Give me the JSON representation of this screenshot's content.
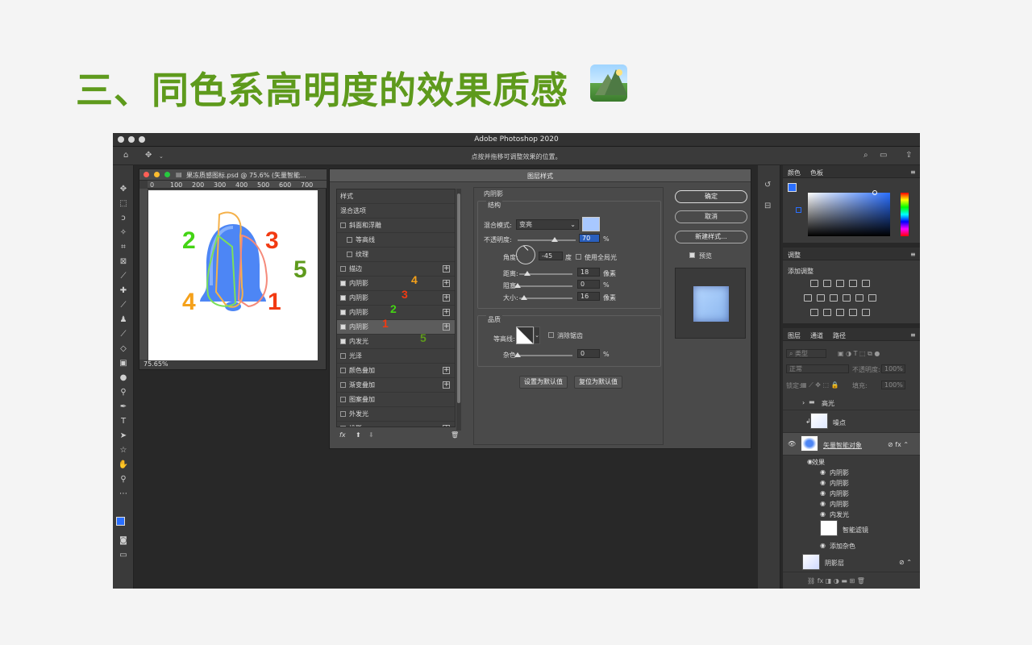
{
  "slide": {
    "title": "三、同色系高明度的效果质感"
  },
  "app": {
    "title": "Adobe Photoshop 2020",
    "hint": "点按并拖移可调整效果的位置。"
  },
  "document": {
    "title": "果冻质感图标.psd @ 75.6% (矢量智能...",
    "zoom": "75.65%",
    "ruler": [
      "0",
      "100",
      "200",
      "300",
      "400",
      "500",
      "600",
      "700"
    ],
    "labels": [
      {
        "text": "2",
        "color": "#44d414"
      },
      {
        "text": "3",
        "color": "#f23a12"
      },
      {
        "text": "5",
        "color": "#5e9a1c"
      },
      {
        "text": "4",
        "color": "#f5a11a"
      },
      {
        "text": "1",
        "color": "#f23a12"
      }
    ]
  },
  "dialog": {
    "title": "图层样式",
    "style_list": [
      {
        "label": "样式",
        "checkbox": false,
        "plus": false,
        "indent": 0
      },
      {
        "label": "混合选项",
        "checkbox": false,
        "plus": false,
        "indent": 0
      },
      {
        "label": "斜面和浮雕",
        "checkbox": true,
        "checked": false,
        "plus": false,
        "indent": 0
      },
      {
        "label": "等高线",
        "checkbox": true,
        "checked": false,
        "plus": false,
        "indent": 1
      },
      {
        "label": "纹理",
        "checkbox": true,
        "checked": false,
        "plus": false,
        "indent": 1
      },
      {
        "label": "描边",
        "checkbox": true,
        "checked": false,
        "plus": true,
        "indent": 0
      },
      {
        "label": "内阴影",
        "checkbox": true,
        "checked": true,
        "plus": true,
        "indent": 0
      },
      {
        "label": "内阴影",
        "checkbox": true,
        "checked": true,
        "plus": true,
        "indent": 0
      },
      {
        "label": "内阴影",
        "checkbox": true,
        "checked": true,
        "plus": true,
        "indent": 0
      },
      {
        "label": "内阴影",
        "checkbox": true,
        "checked": true,
        "plus": true,
        "indent": 0,
        "selected": true
      },
      {
        "label": "内发光",
        "checkbox": true,
        "checked": true,
        "plus": false,
        "indent": 0
      },
      {
        "label": "光泽",
        "checkbox": true,
        "checked": false,
        "plus": false,
        "indent": 0
      },
      {
        "label": "颜色叠加",
        "checkbox": true,
        "checked": false,
        "plus": true,
        "indent": 0
      },
      {
        "label": "渐变叠加",
        "checkbox": true,
        "checked": false,
        "plus": true,
        "indent": 0
      },
      {
        "label": "图案叠加",
        "checkbox": true,
        "checked": false,
        "plus": false,
        "indent": 0
      },
      {
        "label": "外发光",
        "checkbox": true,
        "checked": false,
        "plus": false,
        "indent": 0
      },
      {
        "label": "投影",
        "checkbox": true,
        "checked": false,
        "plus": true,
        "indent": 0
      }
    ],
    "annotations": [
      {
        "text": "4",
        "color": "#f5a11a"
      },
      {
        "text": "3",
        "color": "#f23a12"
      },
      {
        "text": "2",
        "color": "#44d414"
      },
      {
        "text": "1",
        "color": "#f23a12"
      },
      {
        "text": "5",
        "color": "#5e9a1c"
      }
    ],
    "section": "内阴影",
    "structure": "结构",
    "blend_mode_label": "混合模式:",
    "blend_mode": "变亮",
    "shadow_color": "#a8c8ff",
    "opacity_label": "不透明度:",
    "opacity": "70",
    "angle_label": "角度:",
    "angle": "-45",
    "deg": "度",
    "global_light": "使用全局光",
    "distance_label": "距离:",
    "distance": "18",
    "choke_label": "阻塞:",
    "choke": "0",
    "size_label": "大小:",
    "size": "16",
    "px": "像素",
    "pct": "%",
    "quality": "品质",
    "contour_label": "等高线:",
    "antialias": "消除锯齿",
    "noise_label": "杂色:",
    "noise": "0",
    "set_default": "设置为默认值",
    "reset_default": "复位为默认值",
    "ok": "确定",
    "cancel": "取消",
    "new_style": "新建样式...",
    "preview": "预览"
  },
  "panels": {
    "color_tab": "颜色",
    "swatch_tab": "色板",
    "adjust_tab": "调整",
    "add_adjust": "添加调整",
    "layers_tab": "图层",
    "channels_tab": "通道",
    "paths_tab": "路径",
    "kind": "类型",
    "blend": "正常",
    "opacity_label": "不透明度:",
    "opacity": "100%",
    "lock_label": "锁定:",
    "fill_label": "填充:",
    "fill": "100%",
    "layers": {
      "highlight": "高光",
      "noise": "噪点",
      "smart": "矢量智能对象",
      "effects": "效果",
      "fx": [
        "内阴影",
        "内阴影",
        "内阴影",
        "内阴影",
        "内发光"
      ],
      "smart_filters": "智能滤镜",
      "add_noise": "添加杂色",
      "shadow": "阴影层"
    }
  }
}
